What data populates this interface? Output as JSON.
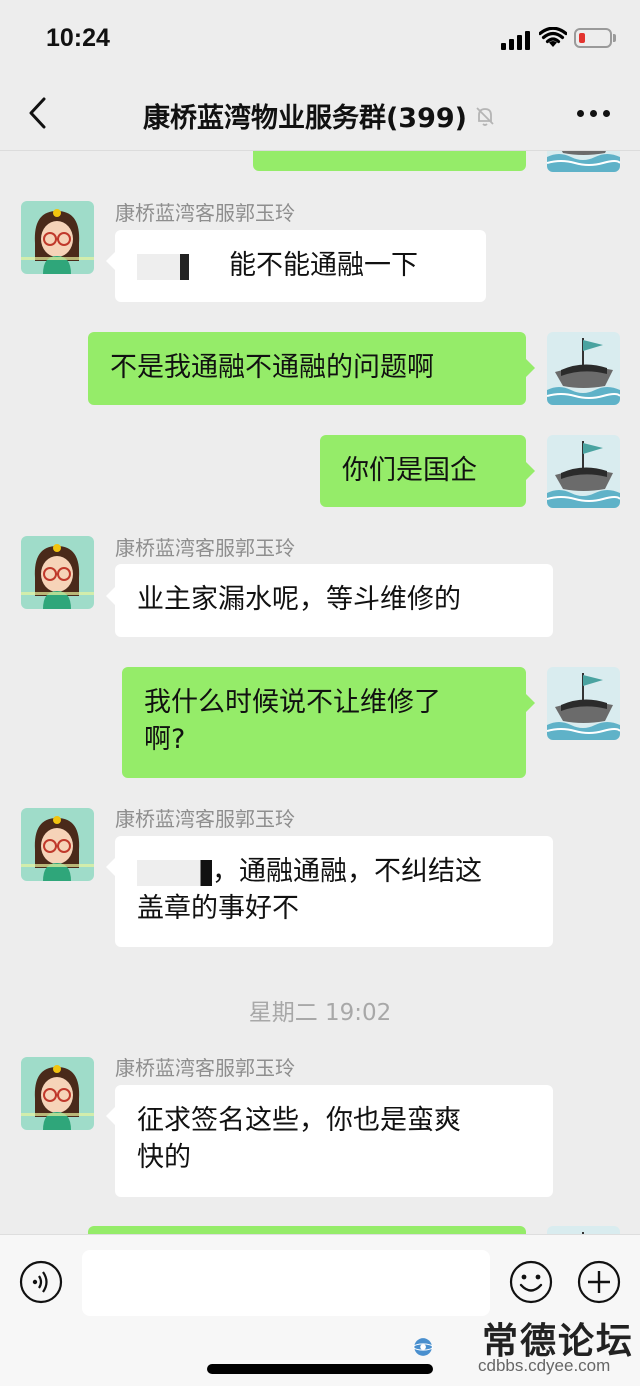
{
  "status_bar": {
    "time": "10:24"
  },
  "header": {
    "title": "康桥蓝湾物业服务群(399)"
  },
  "messages": [
    {
      "sender": "康桥蓝湾客服郭玉玲",
      "text": "能不能通融一下"
    },
    {
      "text": "不是我通融不通融的问题啊"
    },
    {
      "text": "你们是国企"
    },
    {
      "sender": "康桥蓝湾客服郭玉玲",
      "text": "业主家漏水呢，等斗维修的"
    },
    {
      "lines": [
        "我什么时候说不让维修了",
        "啊?"
      ]
    },
    {
      "sender": "康桥蓝湾客服郭玉玲",
      "lines": [
        "，通融通融，不纠结这",
        "盖章的事好不"
      ]
    },
    {
      "sender": "康桥蓝湾客服郭玉玲",
      "lines": [
        "征求签名这些，你也是蛮爽",
        "快的"
      ]
    }
  ],
  "timestamp": "星期二 19:02",
  "watermark": {
    "title": "常德论坛",
    "url": "cdbbs.cdyee.com"
  },
  "icons": {
    "back": "chevron-left-icon",
    "mute": "bell-slash-icon",
    "more": "more-dots-icon",
    "voice": "voice-icon",
    "emoji": "emoji-icon",
    "plus": "plus-circle-icon"
  },
  "colors": {
    "outgoing_bubble": "#95ec69",
    "incoming_bubble": "#ffffff",
    "background": "#ededed"
  }
}
